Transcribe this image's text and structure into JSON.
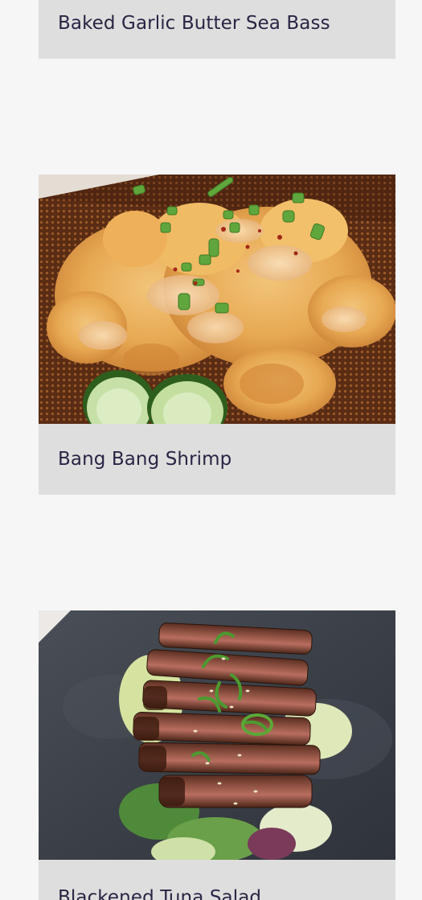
{
  "recipes": [
    {
      "title": "Baked Garlic Butter Sea Bass",
      "image": "sea-bass-photo"
    },
    {
      "title": "Bang Bang Shrimp",
      "image": "bang-bang-shrimp-photo"
    },
    {
      "title": "Blackened Tuna Salad",
      "image": "blackened-tuna-salad-photo"
    }
  ],
  "colors": {
    "page_background": "#f6f6f6",
    "title_bar": "#dedede",
    "title_text": "#2a2444"
  }
}
